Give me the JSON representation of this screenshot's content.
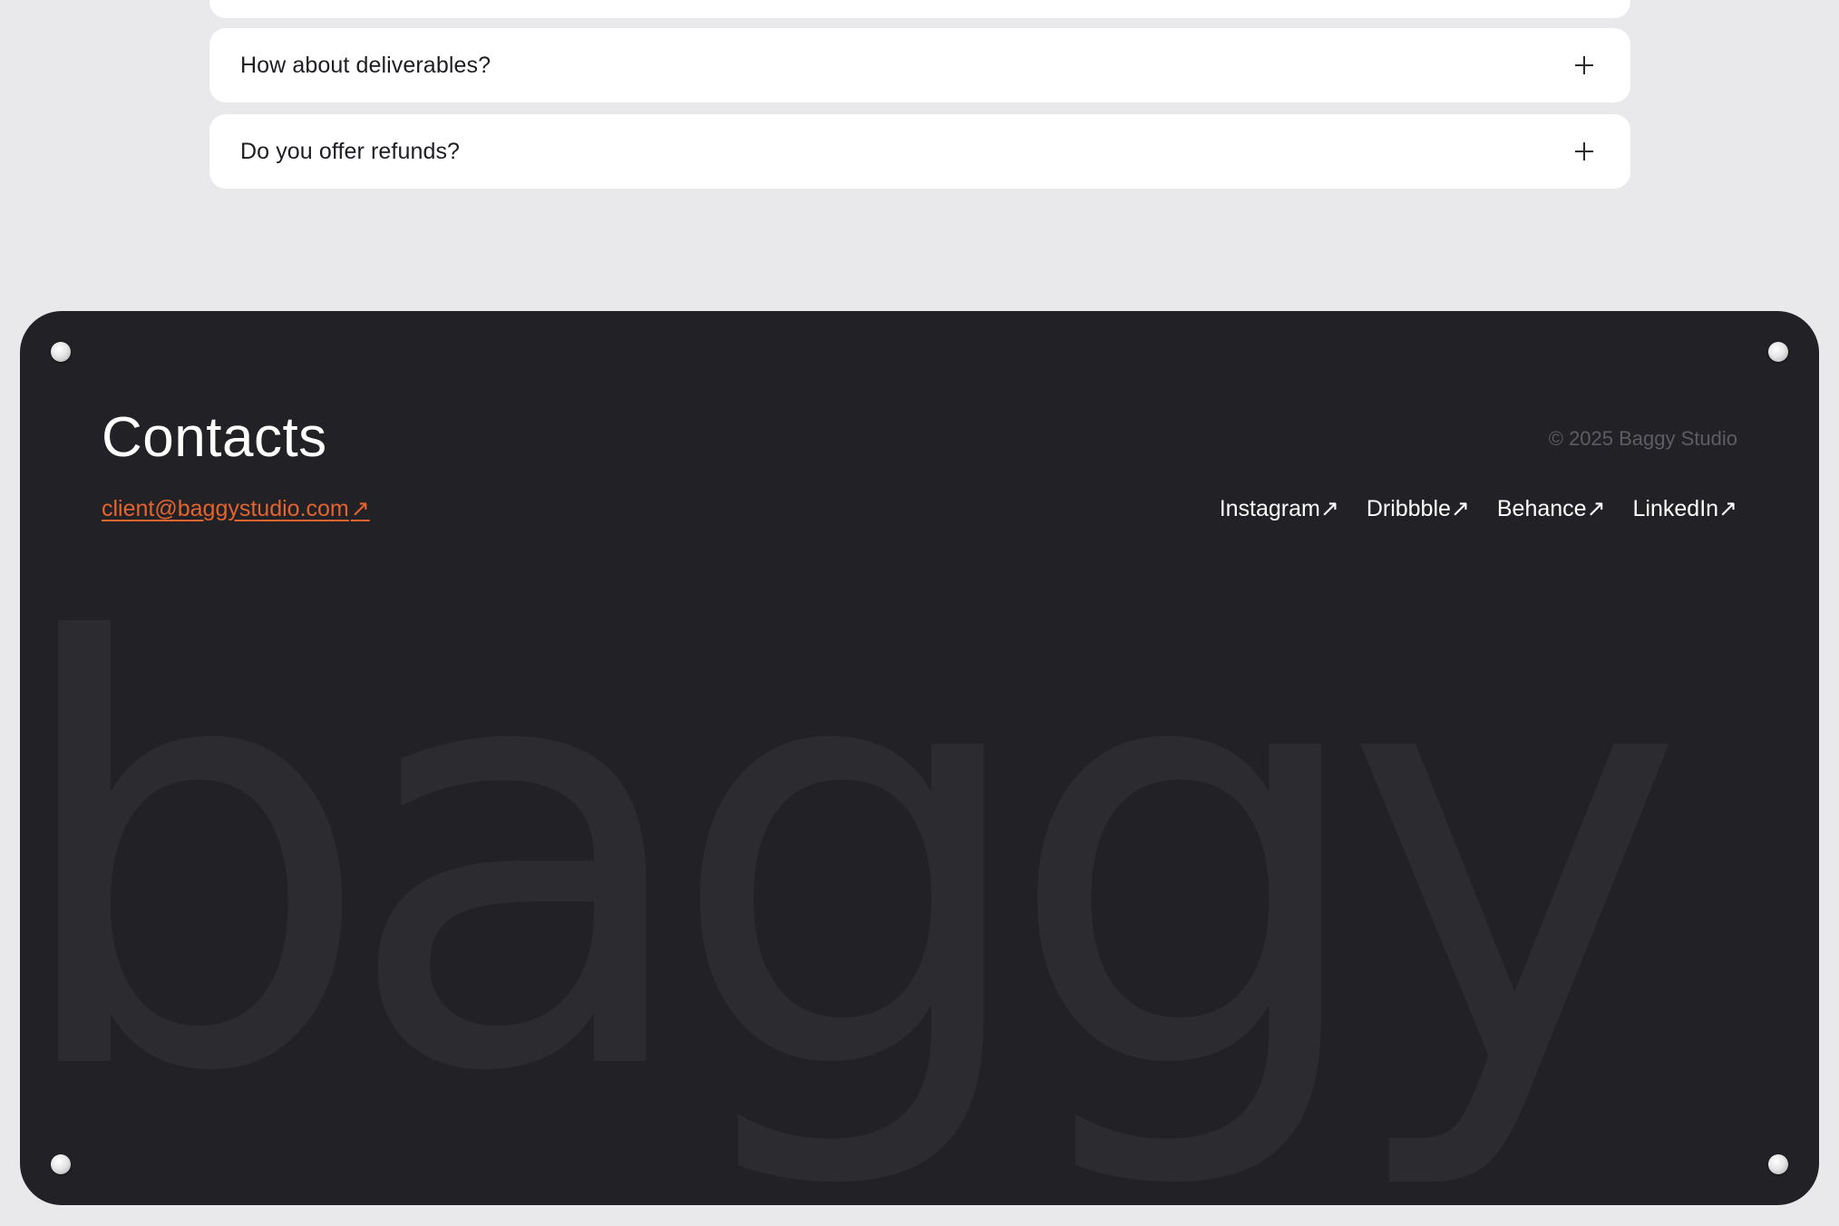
{
  "faq": {
    "items": [
      {
        "question": "",
        "expanded": false
      },
      {
        "question": "How about deliverables?",
        "expanded": false
      },
      {
        "question": "Do you offer refunds?",
        "expanded": false
      }
    ]
  },
  "footer": {
    "title": "Contacts",
    "copyright": "© 2025 Baggy Studio",
    "email": "client@baggystudio.com",
    "email_arrow": "↗",
    "social": [
      {
        "label": "Instagram↗"
      },
      {
        "label": "Dribbble↗"
      },
      {
        "label": "Behance↗"
      },
      {
        "label": "LinkedIn↗"
      }
    ],
    "watermark": "baggy"
  },
  "colors": {
    "page_background": "#e9e8ea",
    "card_background": "#ffffff",
    "footer_background": "#222125",
    "accent": "#e3642e",
    "watermark": "#2c2b2f",
    "muted_text": "#5e5d63"
  },
  "icons": {
    "faq_toggle": "plus-icon",
    "footer_corners": "screw-icon"
  }
}
